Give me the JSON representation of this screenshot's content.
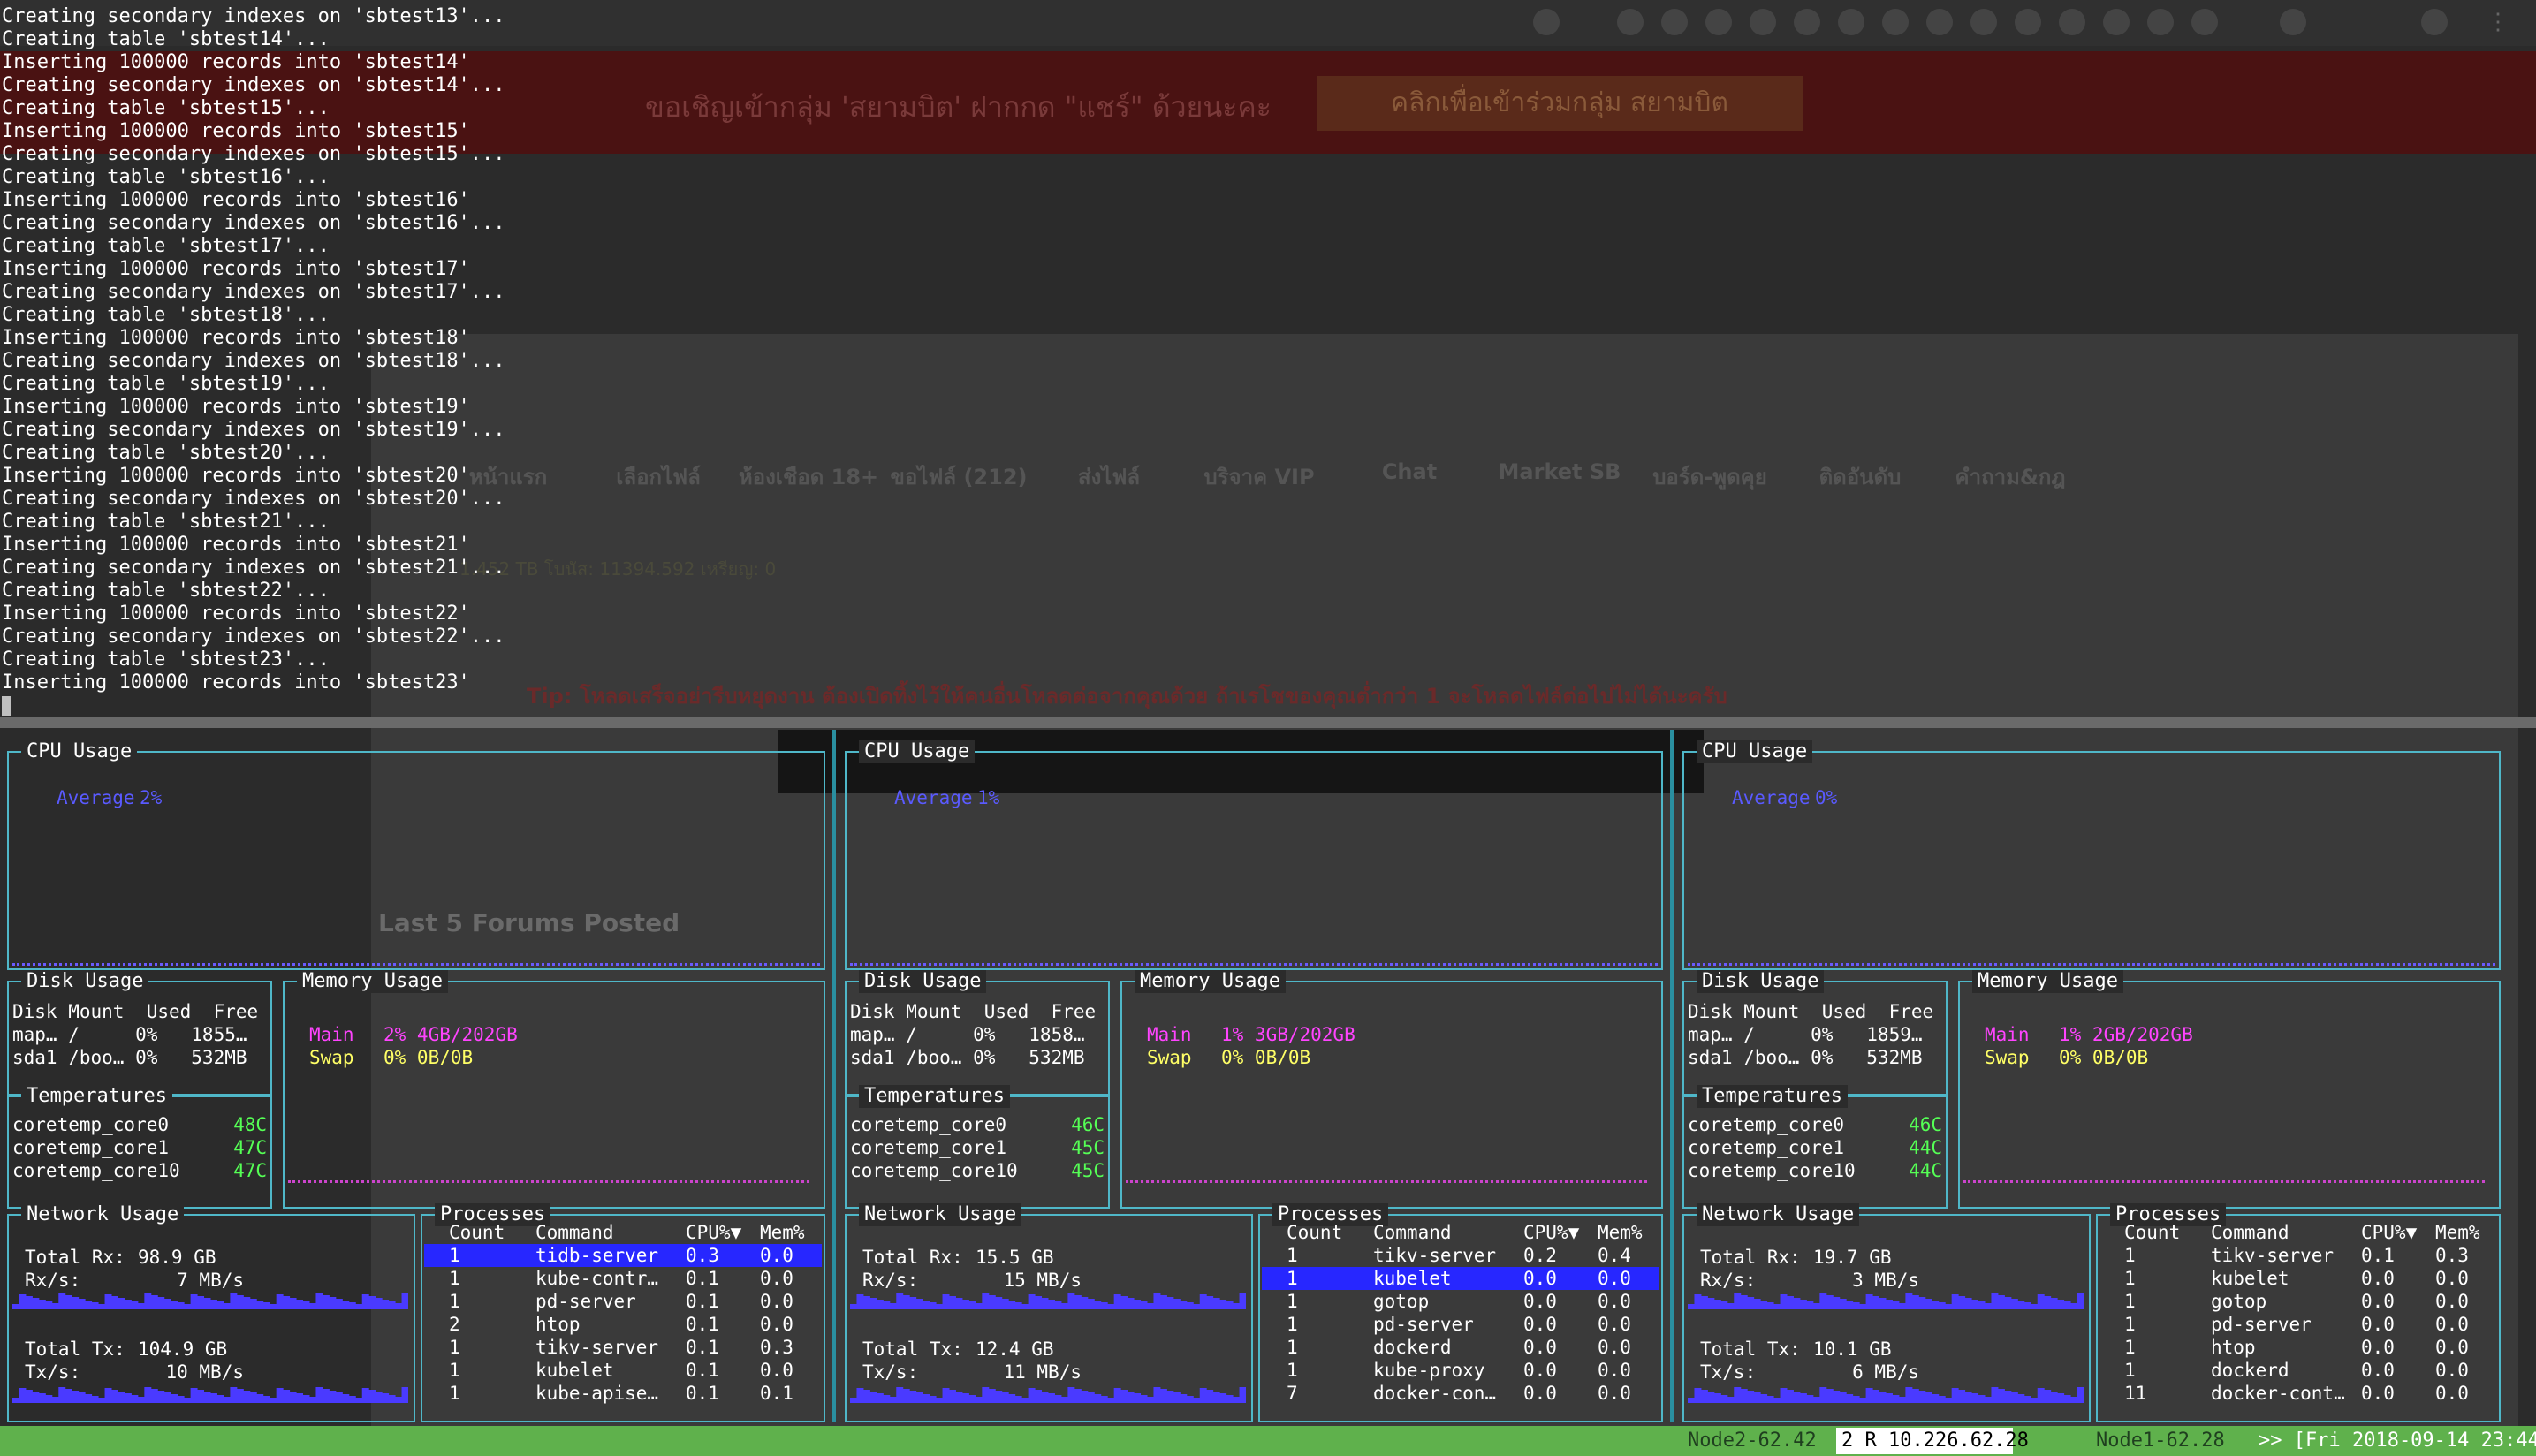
{
  "terminal_log": [
    "Creating secondary indexes on 'sbtest13'...",
    "Creating table 'sbtest14'...",
    "Inserting 100000 records into 'sbtest14'",
    "Creating secondary indexes on 'sbtest14'...",
    "Creating table 'sbtest15'...",
    "Inserting 100000 records into 'sbtest15'",
    "Creating secondary indexes on 'sbtest15'...",
    "Creating table 'sbtest16'...",
    "Inserting 100000 records into 'sbtest16'",
    "Creating secondary indexes on 'sbtest16'...",
    "Creating table 'sbtest17'...",
    "Inserting 100000 records into 'sbtest17'",
    "Creating secondary indexes on 'sbtest17'...",
    "Creating table 'sbtest18'...",
    "Inserting 100000 records into 'sbtest18'",
    "Creating secondary indexes on 'sbtest18'...",
    "Creating table 'sbtest19'...",
    "Inserting 100000 records into 'sbtest19'",
    "Creating secondary indexes on 'sbtest19'...",
    "Creating table 'sbtest20'...",
    "Inserting 100000 records into 'sbtest20'",
    "Creating secondary indexes on 'sbtest20'...",
    "Creating table 'sbtest21'...",
    "Inserting 100000 records into 'sbtest21'",
    "Creating secondary indexes on 'sbtest21'...",
    "Creating table 'sbtest22'...",
    "Inserting 100000 records into 'sbtest22'",
    "Creating secondary indexes on 'sbtest22'...",
    "Creating table 'sbtest23'...",
    "Inserting 100000 records into 'sbtest23'"
  ],
  "background": {
    "banner_text": "ขอเชิญเข้ากลุ่ม 'สยามบิต' ฝากกด \"แชร์\" ด้วยนะคะ",
    "banner_button": "คลิกเพื่อเข้าร่วมกลุ่ม สยามบิต",
    "nav_items": [
      "หน้าแรก",
      "เลือกไฟล์",
      "ห้องเชือด 18+",
      "ขอไฟล์ (212)",
      "ส่งไฟล์",
      "บริจาค VIP",
      "Chat",
      "Market SB",
      "บอร์ด-พูดคุย",
      "ติดอันดับ",
      "คำถาม&กฎ"
    ],
    "status_line": "1.452 TB   โบนัส: 11394.592  เหรียญ: 0",
    "tip": "Tip: โหลดเสร็จอย่ารีบหยุดงาน ต้องเปิดทิ้งไว้ให้คนอื่นโหลดต่อจากคุณด้วย ถ้าเรโชของคุณต่ำกว่า 1 จะโหลดไฟล์ต่อไปไม่ได้นะครับ",
    "forums_heading": "Last 5 Forums Posted"
  },
  "labels": {
    "cpu": "CPU Usage",
    "disk": "Disk Usage",
    "memory": "Memory Usage",
    "temps": "Temperatures",
    "network": "Network Usage",
    "processes": "Processes",
    "average": "Average",
    "main": "Main",
    "swap": "Swap",
    "total_rx": "Total Rx:",
    "rx_s": "Rx/s:",
    "total_tx": "Total Tx:",
    "tx_s": "Tx/s:",
    "disk_header": "Disk Mount  Used  Free",
    "proc_header": [
      "Count",
      "Command",
      "CPU%▼",
      "Mem%"
    ]
  },
  "panes": [
    {
      "cpu_avg": "2%",
      "disks": [
        "map… /     0%   1855…",
        "sda1 /boo… 0%   532MB"
      ],
      "mem_main": "2% 4GB/202GB",
      "mem_swap": "0% 0B/0B",
      "temps": [
        [
          "coretemp_core0",
          "48C"
        ],
        [
          "coretemp_core1",
          "47C"
        ],
        [
          "coretemp_core10",
          "47C"
        ]
      ],
      "total_rx": "98.9 GB",
      "rx_s": "7 MB/s",
      "total_tx": "104.9 GB",
      "tx_s": "10 MB/s",
      "processes": [
        [
          "1",
          "tidb-server",
          "0.3",
          "0.0"
        ],
        [
          "1",
          "kube-contr…",
          "0.1",
          "0.0"
        ],
        [
          "1",
          "pd-server",
          "0.1",
          "0.0"
        ],
        [
          "2",
          "htop",
          "0.1",
          "0.0"
        ],
        [
          "1",
          "tikv-server",
          "0.1",
          "0.3"
        ],
        [
          "1",
          "kubelet",
          "0.1",
          "0.0"
        ],
        [
          "1",
          "kube-apise…",
          "0.1",
          "0.1"
        ]
      ],
      "selected_row": 0
    },
    {
      "cpu_avg": "1%",
      "disks": [
        "map… /     0%   1858…",
        "sda1 /boo… 0%   532MB"
      ],
      "mem_main": "1% 3GB/202GB",
      "mem_swap": "0% 0B/0B",
      "temps": [
        [
          "coretemp_core0",
          "46C"
        ],
        [
          "coretemp_core1",
          "45C"
        ],
        [
          "coretemp_core10",
          "45C"
        ]
      ],
      "total_rx": "15.5 GB",
      "rx_s": "15 MB/s",
      "total_tx": "12.4 GB",
      "tx_s": "11 MB/s",
      "processes": [
        [
          "1",
          "tikv-server",
          "0.2",
          "0.4"
        ],
        [
          "1",
          "kubelet",
          "0.0",
          "0.0"
        ],
        [
          "1",
          "gotop",
          "0.0",
          "0.0"
        ],
        [
          "1",
          "pd-server",
          "0.0",
          "0.0"
        ],
        [
          "1",
          "dockerd",
          "0.0",
          "0.0"
        ],
        [
          "1",
          "kube-proxy",
          "0.0",
          "0.0"
        ],
        [
          "7",
          "docker-con…",
          "0.0",
          "0.0"
        ]
      ],
      "selected_row": 1
    },
    {
      "cpu_avg": "0%",
      "disks": [
        "map… /     0%   1859…",
        "sda1 /boo… 0%   532MB"
      ],
      "mem_main": "1% 2GB/202GB",
      "mem_swap": "0% 0B/0B",
      "temps": [
        [
          "coretemp_core0",
          "46C"
        ],
        [
          "coretemp_core1",
          "44C"
        ],
        [
          "coretemp_core10",
          "44C"
        ]
      ],
      "total_rx": "19.7 GB",
      "rx_s": "3 MB/s",
      "total_tx": "10.1 GB",
      "tx_s": "6 MB/s",
      "processes": [
        [
          "1",
          "tikv-server",
          "0.1",
          "0.3"
        ],
        [
          "1",
          "kubelet",
          "0.0",
          "0.0"
        ],
        [
          "1",
          "gotop",
          "0.0",
          "0.0"
        ],
        [
          "1",
          "pd-server",
          "0.0",
          "0.0"
        ],
        [
          "1",
          "htop",
          "0.0",
          "0.0"
        ],
        [
          "1",
          "dockerd",
          "0.0",
          "0.0"
        ],
        [
          "11",
          "docker-cont…",
          "0.0",
          "0.0"
        ]
      ],
      "selected_row": -1
    }
  ],
  "statusbar": {
    "win_node2": "Node2-62.42",
    "win_active": "2 R 10.226.62.28",
    "win_node1": "Node1-62.28",
    "clock": ">> [Fri 2018-09-14 23:44]"
  },
  "colors": {
    "border": "#4fb7c8",
    "accent_blue": "#5a5aff",
    "magenta": "#ff44ff",
    "yellow": "#ffff66",
    "green": "#55ff55",
    "status_green": "#5fb14c",
    "selection": "#2727ff"
  }
}
